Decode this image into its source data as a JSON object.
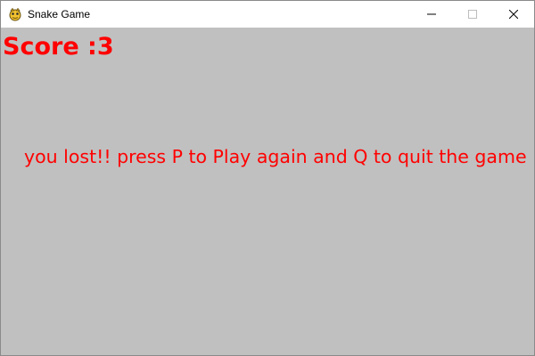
{
  "window": {
    "title": "Snake Game",
    "app_icon": "pygame-snake-icon",
    "controls": {
      "minimize_icon": "minimize-icon",
      "maximize_icon": "maximize-icon",
      "close_icon": "close-icon"
    }
  },
  "game": {
    "background_color": "#c0c0c0",
    "text_color": "#ff0000",
    "score_text": "Score :3",
    "message": "you lost!! press P to Play again and Q to quit the game"
  }
}
